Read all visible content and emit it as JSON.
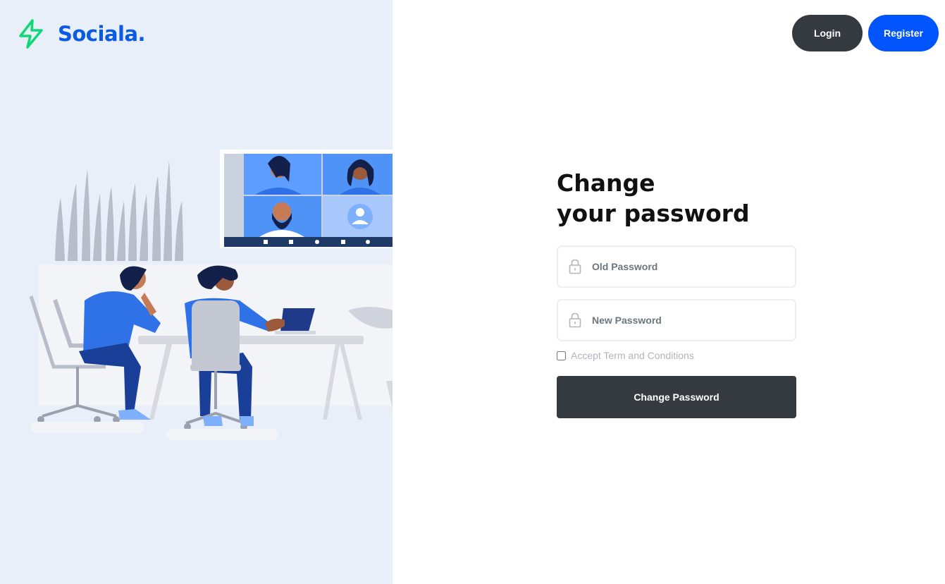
{
  "brand": {
    "name": "Sociala.",
    "logo_icon": "lightning-bolt-icon",
    "logo_color": "#10d876",
    "name_color": "#0b5ae3"
  },
  "header": {
    "login_label": "Login",
    "register_label": "Register"
  },
  "form": {
    "title_line1": "Change",
    "title_line2": "your password",
    "old_password": {
      "placeholder": "Old Password",
      "value": "",
      "icon": "lock-icon"
    },
    "new_password": {
      "placeholder": "New Password",
      "value": "",
      "icon": "lock-icon"
    },
    "terms_label": "Accept Term and Conditions",
    "terms_checked": false,
    "submit_label": "Change Password"
  },
  "colors": {
    "dark": "#343a40",
    "primary": "#0055ff",
    "panel_bg": "#e8eff9"
  }
}
